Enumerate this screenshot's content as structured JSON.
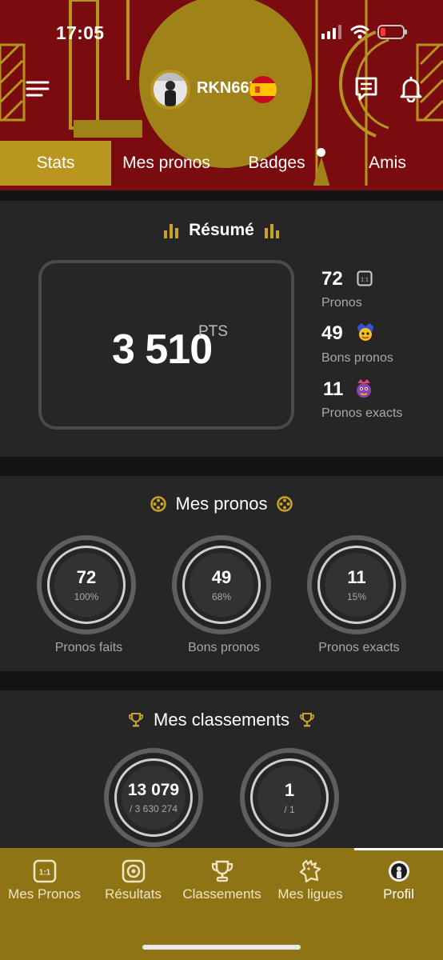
{
  "status_bar": {
    "time": "17:05"
  },
  "header": {
    "username": "RKN667",
    "flag": "spain-flag",
    "colors": {
      "background": "#7a0c10",
      "accent": "#b8961f"
    }
  },
  "tabs": [
    {
      "label": "Stats",
      "active": true
    },
    {
      "label": "Mes pronos",
      "active": false
    },
    {
      "label": "Badges",
      "active": false
    },
    {
      "label": "Amis",
      "active": false
    }
  ],
  "resume": {
    "title": "Résumé",
    "points": "3 510",
    "points_unit": "PTS",
    "stats": [
      {
        "value": "72",
        "label": "Pronos",
        "icon": "one-one-icon"
      },
      {
        "value": "49",
        "label": "Bons pronos",
        "icon": "mascot-yellow-icon"
      },
      {
        "value": "11",
        "label": "Pronos exacts",
        "icon": "mascot-purple-icon"
      }
    ]
  },
  "mes_pronos": {
    "title": "Mes pronos",
    "rings": [
      {
        "value": "72",
        "sub": "100%",
        "label": "Pronos faits"
      },
      {
        "value": "49",
        "sub": "68%",
        "label": "Bons pronos"
      },
      {
        "value": "11",
        "sub": "15%",
        "label": "Pronos exacts"
      }
    ]
  },
  "classements": {
    "title": "Mes classements",
    "rings": [
      {
        "value": "13 079",
        "sub": "/ 3 630 274"
      },
      {
        "value": "1",
        "sub": "/ 1"
      }
    ]
  },
  "bottom_nav": [
    {
      "label": "Mes Pronos",
      "icon": "one-one-icon",
      "active": false
    },
    {
      "label": "Résultats",
      "icon": "ball-icon",
      "active": false
    },
    {
      "label": "Classements",
      "icon": "trophy-icon",
      "active": false
    },
    {
      "label": "Mes ligues",
      "icon": "rooster-icon",
      "active": false
    },
    {
      "label": "Profil",
      "icon": "profile-avatar-icon",
      "active": true
    }
  ]
}
